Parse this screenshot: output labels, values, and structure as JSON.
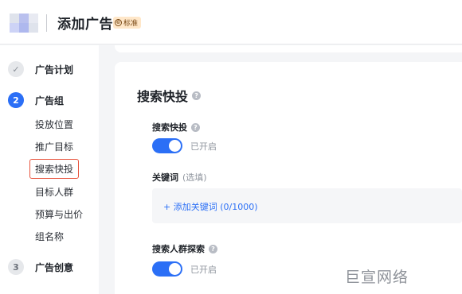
{
  "header": {
    "title": "添加广告",
    "badge_icon": "©",
    "badge_label": "标准",
    "logo_colors": [
      "#dfe3ec",
      "#b9c0ee",
      "#e8eaf2",
      "#cdd3f6",
      "#aeb8ee",
      "#dfe3ec"
    ]
  },
  "sidebar": {
    "steps": [
      {
        "marker": "✓",
        "label": "广告计划",
        "state": "done"
      },
      {
        "marker": "2",
        "label": "广告组",
        "state": "active"
      },
      {
        "marker": "3",
        "label": "广告创意",
        "state": "todo"
      }
    ],
    "sub_items": [
      "投放位置",
      "推广目标",
      "搜索快投",
      "目标人群",
      "预算与出价",
      "组名称"
    ],
    "current_sub_item": "搜索快投"
  },
  "main": {
    "section_title": "搜索快投",
    "help_icon": "?",
    "search_quick": {
      "label": "搜索快投",
      "toggle_status": "已开启",
      "enabled": true
    },
    "keywords": {
      "label": "关键词",
      "optional": "(选填)",
      "add_link": "+ 添加关键词 (0/1000)"
    },
    "audience_explore": {
      "label": "搜索人群探索",
      "toggle_status": "已开启",
      "enabled": true
    }
  },
  "watermark": "巨宣网络",
  "colors": {
    "primary": "#2b6ff6",
    "highlight_border": "#e8553e",
    "badge_bg": "#ffe7c9"
  }
}
